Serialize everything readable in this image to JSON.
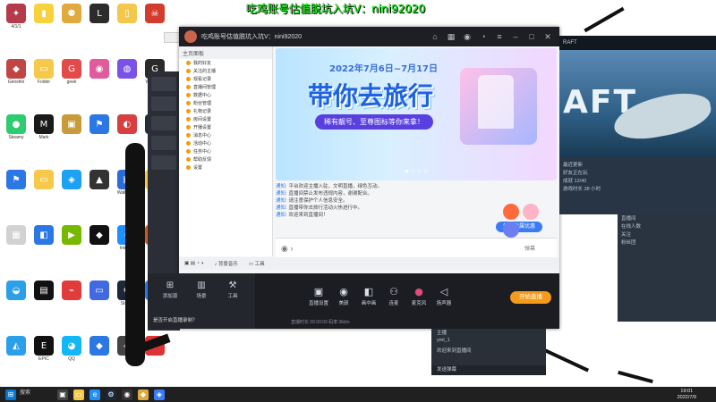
{
  "overlay": {
    "text": "吃鸡账号估值脱坑入坑V：nini92020"
  },
  "desktop_icons": [
    {
      "label": "4/1/1",
      "color": "#b53a4a",
      "glyph": "✦"
    },
    {
      "label": "",
      "color": "#f7d23e",
      "glyph": "▮"
    },
    {
      "label": "",
      "color": "#e0aa3e",
      "glyph": "⚉"
    },
    {
      "label": "",
      "color": "#2c2c2c",
      "glyph": "L"
    },
    {
      "label": "",
      "color": "#f4c84b",
      "glyph": "▯"
    },
    {
      "label": "",
      "color": "#d33c2c",
      "glyph": "☠"
    },
    {
      "label": "Genshin",
      "color": "#c04545",
      "glyph": "◆"
    },
    {
      "label": "Folder",
      "color": "#f6c94a",
      "glyph": "▭"
    },
    {
      "label": "geek",
      "color": "#e34b4b",
      "glyph": "G"
    },
    {
      "label": "",
      "color": "#e05a9c",
      "glyph": "◉"
    },
    {
      "label": "",
      "color": "#7b52e8",
      "glyph": "◍"
    },
    {
      "label": "WeGame",
      "color": "#2a2a2a",
      "glyph": "G"
    },
    {
      "label": "Steamy",
      "color": "#2ecc71",
      "glyph": "●"
    },
    {
      "label": "Mark",
      "color": "#1a1a1a",
      "glyph": "M"
    },
    {
      "label": "",
      "color": "#c89a3a",
      "glyph": "▣"
    },
    {
      "label": "",
      "color": "#2b78e4",
      "glyph": "⚑"
    },
    {
      "label": "",
      "color": "#d64040",
      "glyph": "◐"
    },
    {
      "label": "",
      "color": "#1f2a44",
      "glyph": "⚙"
    },
    {
      "label": "",
      "color": "#2b78e4",
      "glyph": "⚑"
    },
    {
      "label": "",
      "color": "#f6c94a",
      "glyph": "▭"
    },
    {
      "label": "",
      "color": "#1da1f2",
      "glyph": "◈"
    },
    {
      "label": "",
      "color": "#333",
      "glyph": "▲"
    },
    {
      "label": "Wallpaper",
      "color": "#2d6cd8",
      "glyph": "▣"
    },
    {
      "label": "Doc",
      "color": "#f6c94a",
      "glyph": "▭"
    },
    {
      "label": "",
      "color": "#d2d2d2",
      "glyph": "▦"
    },
    {
      "label": "",
      "color": "#2b78e4",
      "glyph": "◧"
    },
    {
      "label": "",
      "color": "#76b900",
      "glyph": "▶"
    },
    {
      "label": "",
      "color": "#111",
      "glyph": "◆"
    },
    {
      "label": "Internet",
      "color": "#1e90ff",
      "glyph": "e"
    },
    {
      "label": "",
      "color": "#cc5a20",
      "glyph": "◎"
    },
    {
      "label": "",
      "color": "#2ba0e8",
      "glyph": "◒"
    },
    {
      "label": "",
      "color": "#111",
      "glyph": "▤"
    },
    {
      "label": "",
      "color": "#e03c3c",
      "glyph": "⌁"
    },
    {
      "label": "",
      "color": "#4169e1",
      "glyph": "▭"
    },
    {
      "label": "Steam",
      "color": "#1b2838",
      "glyph": "⚙"
    },
    {
      "label": "",
      "color": "#2b78e4",
      "glyph": "K"
    },
    {
      "label": "",
      "color": "#2ba0e8",
      "glyph": "◭"
    },
    {
      "label": "EPIC",
      "color": "#111",
      "glyph": "E"
    },
    {
      "label": "QQ",
      "color": "#12b7f5",
      "glyph": "◕"
    },
    {
      "label": "",
      "color": "#2b78e4",
      "glyph": "◆"
    },
    {
      "label": "",
      "color": "#444",
      "glyph": "◈"
    },
    {
      "label": "",
      "color": "#d33",
      "glyph": "✦"
    }
  ],
  "main_window": {
    "title": "吃鸡账号估值脱坑入坑V：nini92020",
    "side_header": "主页面板",
    "side_rows": [
      "我的好友",
      "关注的主播",
      "观看记录",
      "直播间管理",
      "数据中心",
      "粉丝管理",
      "礼物记录",
      "房间设置",
      "开播设置",
      "消息中心",
      "活动中心",
      "任务中心",
      "帮助反馈",
      "设置"
    ],
    "banner_date": "2022年7月6日~7月17日",
    "banner_title": "带你去旅行",
    "banner_pill": "稀有靓号、至尊图标等你来拿！",
    "chat_messages": [
      {
        "tag": "通知:",
        "text": "平台欢迎主播入驻，文明直播，绿色互动。"
      },
      {
        "tag": "通知:",
        "text": "直播间禁止发布违规内容，谢谢配合。"
      },
      {
        "tag": "通知:",
        "text": "请注意保护个人信息安全。"
      },
      {
        "tag": "通知:",
        "text": "直播带你去旅行活动火热进行中。"
      },
      {
        "tag": "通知:",
        "text": "欢迎来到直播间！"
      }
    ],
    "chat_button": "领取专属优惠",
    "input_hint": "弹幕"
  },
  "controls": {
    "buttons": [
      "直播设置",
      "美颜",
      "画中画",
      "连麦",
      "麦克风",
      "扬声器"
    ],
    "go_live": "开始直播",
    "status": "直播时长 00:00:00  码率 0kb/s"
  },
  "left_ctrl": {
    "buttons": [
      "添加源",
      "场景",
      "工具"
    ],
    "question": "是否开启直播录制？"
  },
  "game": {
    "header": "RAFT",
    "word": "AFT",
    "panel_rows": [
      "最近更新",
      "好友正在玩",
      "成就 12/40",
      "游戏时长 38 小时"
    ]
  },
  "right_panel": {
    "rows": [
      "直播间",
      "在线人数",
      "关注",
      "粉丝团"
    ]
  },
  "chat_lower": {
    "rows": [
      "主播",
      "yml_1",
      "欢迎来到直播间"
    ],
    "bar": "发送弹幕"
  },
  "taskbar": {
    "search": "搜索",
    "time": "19:01",
    "date": "2022/7/9"
  }
}
